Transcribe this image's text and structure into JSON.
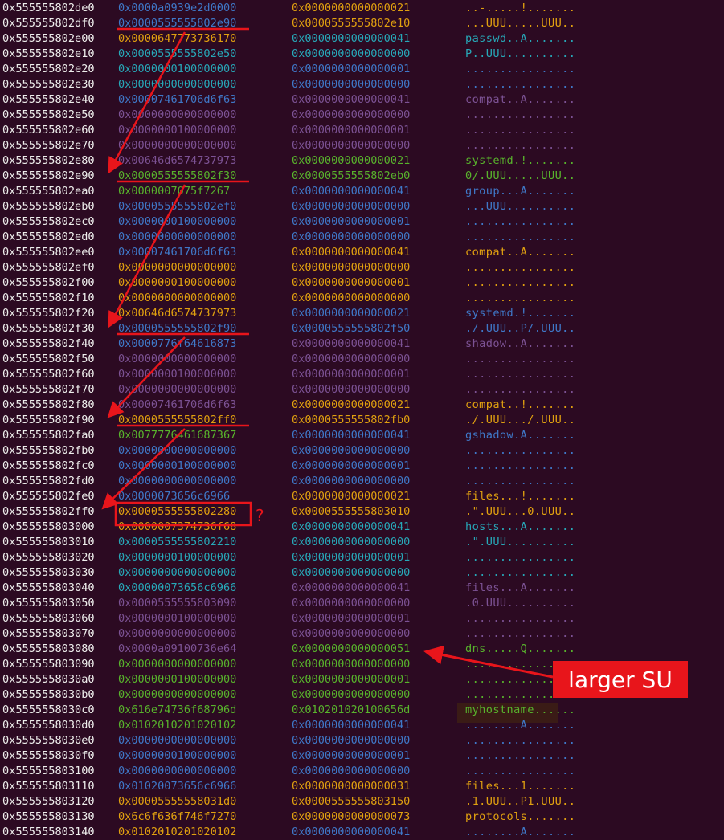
{
  "colors": {
    "background": "#2c0a22",
    "address": "#eeeeec",
    "blue": "#3f78c8",
    "teal": "#27a8b8",
    "green": "#58b32c",
    "orange": "#e0a010",
    "purple": "#7c5294",
    "annotation": "#e8151b"
  },
  "rows": [
    {
      "addr": "0x555555802de0",
      "q1": "0x0000a0939e2d0000",
      "c1": "blue",
      "q2": "0x0000000000000021",
      "c2": "orange",
      "ascii": "..-.....!.......",
      "c3": "orange"
    },
    {
      "addr": "0x555555802df0",
      "q1": "0x0000555555802e90",
      "c1": "blue",
      "q2": "0x0000555555802e10",
      "c2": "orange",
      "ascii": "...UUU.....UUU..",
      "c3": "orange"
    },
    {
      "addr": "0x555555802e00",
      "q1": "0x0000647773736170",
      "c1": "orange",
      "q2": "0x0000000000000041",
      "c2": "teal",
      "ascii": "passwd..A.......",
      "c3": "teal"
    },
    {
      "addr": "0x555555802e10",
      "q1": "0x0000555555802e50",
      "c1": "teal",
      "q2": "0x0000000000000000",
      "c2": "teal",
      "ascii": "P..UUU..........",
      "c3": "teal"
    },
    {
      "addr": "0x555555802e20",
      "q1": "0x0000000100000000",
      "c1": "teal",
      "q2": "0x0000000000000001",
      "c2": "blue",
      "ascii": "................",
      "c3": "blue"
    },
    {
      "addr": "0x555555802e30",
      "q1": "0x0000000000000000",
      "c1": "teal",
      "q2": "0x0000000000000000",
      "c2": "blue",
      "ascii": "................",
      "c3": "blue"
    },
    {
      "addr": "0x555555802e40",
      "q1": "0x00007461706d6f63",
      "c1": "blue",
      "q2": "0x0000000000000041",
      "c2": "purple",
      "ascii": "compat..A.......",
      "c3": "purple"
    },
    {
      "addr": "0x555555802e50",
      "q1": "0x0000000000000000",
      "c1": "purple",
      "q2": "0x0000000000000000",
      "c2": "purple",
      "ascii": "................",
      "c3": "purple"
    },
    {
      "addr": "0x555555802e60",
      "q1": "0x0000000100000000",
      "c1": "purple",
      "q2": "0x0000000000000001",
      "c2": "purple",
      "ascii": "................",
      "c3": "purple"
    },
    {
      "addr": "0x555555802e70",
      "q1": "0x0000000000000000",
      "c1": "purple",
      "q2": "0x0000000000000000",
      "c2": "purple",
      "ascii": "................",
      "c3": "purple"
    },
    {
      "addr": "0x555555802e80",
      "q1": "0x00646d6574737973",
      "c1": "purple",
      "q2": "0x0000000000000021",
      "c2": "green",
      "ascii": "systemd.!.......",
      "c3": "green"
    },
    {
      "addr": "0x555555802e90",
      "q1": "0x0000555555802f30",
      "c1": "green",
      "q2": "0x0000555555802eb0",
      "c2": "green",
      "ascii": "0/.UUU.....UUU..",
      "c3": "green"
    },
    {
      "addr": "0x555555802ea0",
      "q1": "0x0000007075f7267",
      "c1": "green",
      "q2": "0x0000000000000041",
      "c2": "blue",
      "ascii": "group...A.......",
      "c3": "blue"
    },
    {
      "addr": "0x555555802eb0",
      "q1": "0x0000555555802ef0",
      "c1": "blue",
      "q2": "0x0000000000000000",
      "c2": "blue",
      "ascii": "...UUU..........",
      "c3": "blue"
    },
    {
      "addr": "0x555555802ec0",
      "q1": "0x0000000100000000",
      "c1": "blue",
      "q2": "0x0000000000000001",
      "c2": "blue",
      "ascii": "................",
      "c3": "blue"
    },
    {
      "addr": "0x555555802ed0",
      "q1": "0x0000000000000000",
      "c1": "blue",
      "q2": "0x0000000000000000",
      "c2": "blue",
      "ascii": "................",
      "c3": "blue"
    },
    {
      "addr": "0x555555802ee0",
      "q1": "0x00007461706d6f63",
      "c1": "blue",
      "q2": "0x0000000000000041",
      "c2": "orange",
      "ascii": "compat..A.......",
      "c3": "orange"
    },
    {
      "addr": "0x555555802ef0",
      "q1": "0x0000000000000000",
      "c1": "orange",
      "q2": "0x0000000000000000",
      "c2": "orange",
      "ascii": "................",
      "c3": "orange"
    },
    {
      "addr": "0x555555802f00",
      "q1": "0x0000000100000000",
      "c1": "orange",
      "q2": "0x0000000000000001",
      "c2": "orange",
      "ascii": "................",
      "c3": "orange"
    },
    {
      "addr": "0x555555802f10",
      "q1": "0x0000000000000000",
      "c1": "orange",
      "q2": "0x0000000000000000",
      "c2": "orange",
      "ascii": "................",
      "c3": "orange"
    },
    {
      "addr": "0x555555802f20",
      "q1": "0x00646d6574737973",
      "c1": "orange",
      "q2": "0x0000000000000021",
      "c2": "blue",
      "ascii": "systemd.!.......",
      "c3": "blue"
    },
    {
      "addr": "0x555555802f30",
      "q1": "0x0000555555802f90",
      "c1": "blue",
      "q2": "0x0000555555802f50",
      "c2": "blue",
      "ascii": "./.UUU..P/.UUU..",
      "c3": "blue"
    },
    {
      "addr": "0x555555802f40",
      "q1": "0x0000776f64616873",
      "c1": "blue",
      "q2": "0x0000000000000041",
      "c2": "purple",
      "ascii": "shadow..A.......",
      "c3": "purple"
    },
    {
      "addr": "0x555555802f50",
      "q1": "0x0000000000000000",
      "c1": "purple",
      "q2": "0x0000000000000000",
      "c2": "purple",
      "ascii": "................",
      "c3": "purple"
    },
    {
      "addr": "0x555555802f60",
      "q1": "0x0000000100000000",
      "c1": "purple",
      "q2": "0x0000000000000001",
      "c2": "purple",
      "ascii": "................",
      "c3": "purple"
    },
    {
      "addr": "0x555555802f70",
      "q1": "0x0000000000000000",
      "c1": "purple",
      "q2": "0x0000000000000000",
      "c2": "purple",
      "ascii": "................",
      "c3": "purple"
    },
    {
      "addr": "0x555555802f80",
      "q1": "0x00007461706d6f63",
      "c1": "purple",
      "q2": "0x0000000000000021",
      "c2": "orange",
      "ascii": "compat..!.......",
      "c3": "orange"
    },
    {
      "addr": "0x555555802f90",
      "q1": "0x0000555555802ff0",
      "c1": "orange",
      "q2": "0x0000555555802fb0",
      "c2": "orange",
      "ascii": "./.UUU.../.UUU..",
      "c3": "orange"
    },
    {
      "addr": "0x555555802fa0",
      "q1": "0x0077776461687367",
      "c1": "green",
      "q2": "0x0000000000000041",
      "c2": "blue",
      "ascii": "gshadow.A.......",
      "c3": "blue"
    },
    {
      "addr": "0x555555802fb0",
      "q1": "0x0000000000000000",
      "c1": "blue",
      "q2": "0x0000000000000000",
      "c2": "blue",
      "ascii": "................",
      "c3": "blue"
    },
    {
      "addr": "0x555555802fc0",
      "q1": "0x0000000100000000",
      "c1": "blue",
      "q2": "0x0000000000000001",
      "c2": "blue",
      "ascii": "................",
      "c3": "blue"
    },
    {
      "addr": "0x555555802fd0",
      "q1": "0x0000000000000000",
      "c1": "blue",
      "q2": "0x0000000000000000",
      "c2": "blue",
      "ascii": "................",
      "c3": "blue"
    },
    {
      "addr": "0x555555802fe0",
      "q1": "0x0000073656c6966",
      "c1": "blue",
      "q2": "0x0000000000000021",
      "c2": "orange",
      "ascii": "files...!.......",
      "c3": "orange"
    },
    {
      "addr": "0x555555802ff0",
      "q1": "0x0000555555802280",
      "c1": "orange",
      "q2": "0x0000555555803010",
      "c2": "orange",
      "ascii": ".\".UUU...0.UUU..",
      "c3": "orange"
    },
    {
      "addr": "0x555555803000",
      "q1": "0x0000007374736f68",
      "c1": "orange",
      "q2": "0x0000000000000041",
      "c2": "teal",
      "ascii": "hosts...A.......",
      "c3": "teal"
    },
    {
      "addr": "0x555555803010",
      "q1": "0x0000555555802210",
      "c1": "teal",
      "q2": "0x0000000000000000",
      "c2": "teal",
      "ascii": ".\".UUU..........",
      "c3": "teal"
    },
    {
      "addr": "0x555555803020",
      "q1": "0x0000000100000000",
      "c1": "teal",
      "q2": "0x0000000000000001",
      "c2": "teal",
      "ascii": "................",
      "c3": "teal"
    },
    {
      "addr": "0x555555803030",
      "q1": "0x0000000000000000",
      "c1": "teal",
      "q2": "0x0000000000000000",
      "c2": "teal",
      "ascii": "................",
      "c3": "teal"
    },
    {
      "addr": "0x555555803040",
      "q1": "0x00000073656c6966",
      "c1": "teal",
      "q2": "0x0000000000000041",
      "c2": "purple",
      "ascii": "files...A.......",
      "c3": "purple"
    },
    {
      "addr": "0x555555803050",
      "q1": "0x0000555555803090",
      "c1": "purple",
      "q2": "0x0000000000000000",
      "c2": "purple",
      "ascii": ".0.UUU..........",
      "c3": "purple"
    },
    {
      "addr": "0x555555803060",
      "q1": "0x0000000100000000",
      "c1": "purple",
      "q2": "0x0000000000000001",
      "c2": "purple",
      "ascii": "................",
      "c3": "purple"
    },
    {
      "addr": "0x555555803070",
      "q1": "0x0000000000000000",
      "c1": "purple",
      "q2": "0x0000000000000000",
      "c2": "purple",
      "ascii": "................",
      "c3": "purple"
    },
    {
      "addr": "0x555555803080",
      "q1": "0x0000a09100736e64",
      "c1": "purple",
      "q2": "0x0000000000000051",
      "c2": "green",
      "ascii": "dns.....Q.......",
      "c3": "green"
    },
    {
      "addr": "0x555555803090",
      "q1": "0x0000000000000000",
      "c1": "green",
      "q2": "0x0000000000000000",
      "c2": "green",
      "ascii": "................",
      "c3": "green"
    },
    {
      "addr": "0x5555558030a0",
      "q1": "0x0000000100000000",
      "c1": "green",
      "q2": "0x0000000000000001",
      "c2": "green",
      "ascii": "................",
      "c3": "green"
    },
    {
      "addr": "0x5555558030b0",
      "q1": "0x0000000000000000",
      "c1": "green",
      "q2": "0x0000000000000000",
      "c2": "green",
      "ascii": "................",
      "c3": "green"
    },
    {
      "addr": "0x5555558030c0",
      "q1": "0x616e74736f68796d",
      "c1": "green",
      "q2": "0x010201020100656d",
      "c2": "green",
      "ascii": "myhostname......",
      "c3": "green"
    },
    {
      "addr": "0x5555558030d0",
      "q1": "0x0102010201020102",
      "c1": "green",
      "q2": "0x0000000000000041",
      "c2": "blue",
      "ascii": "........A.......",
      "c3": "blue"
    },
    {
      "addr": "0x5555558030e0",
      "q1": "0x0000000000000000",
      "c1": "blue",
      "q2": "0x0000000000000000",
      "c2": "blue",
      "ascii": "................",
      "c3": "blue"
    },
    {
      "addr": "0x5555558030f0",
      "q1": "0x0000000100000000",
      "c1": "blue",
      "q2": "0x0000000000000001",
      "c2": "blue",
      "ascii": "................",
      "c3": "blue"
    },
    {
      "addr": "0x555555803100",
      "q1": "0x0000000000000000",
      "c1": "blue",
      "q2": "0x0000000000000000",
      "c2": "blue",
      "ascii": "................",
      "c3": "blue"
    },
    {
      "addr": "0x555555803110",
      "q1": "0x01020073656c6966",
      "c1": "blue",
      "q2": "0x0000000000000031",
      "c2": "orange",
      "ascii": "files...1.......",
      "c3": "orange"
    },
    {
      "addr": "0x555555803120",
      "q1": "0x00005555558031d0",
      "c1": "orange",
      "q2": "0x0000555555803150",
      "c2": "orange",
      "ascii": ".1.UUU..P1.UUU..",
      "c3": "orange"
    },
    {
      "addr": "0x555555803130",
      "q1": "0x6c6f636f746f7270",
      "c1": "orange",
      "q2": "0x0000000000000073",
      "c2": "orange",
      "ascii": "protocols.......",
      "c3": "orange"
    },
    {
      "addr": "0x555555803140",
      "q1": "0x0102010201020102",
      "c1": "orange",
      "q2": "0x0000000000000041",
      "c2": "blue",
      "ascii": "........A.......",
      "c3": "blue"
    }
  ],
  "annotations": {
    "callout_text": "larger SU",
    "question_mark": "?"
  }
}
